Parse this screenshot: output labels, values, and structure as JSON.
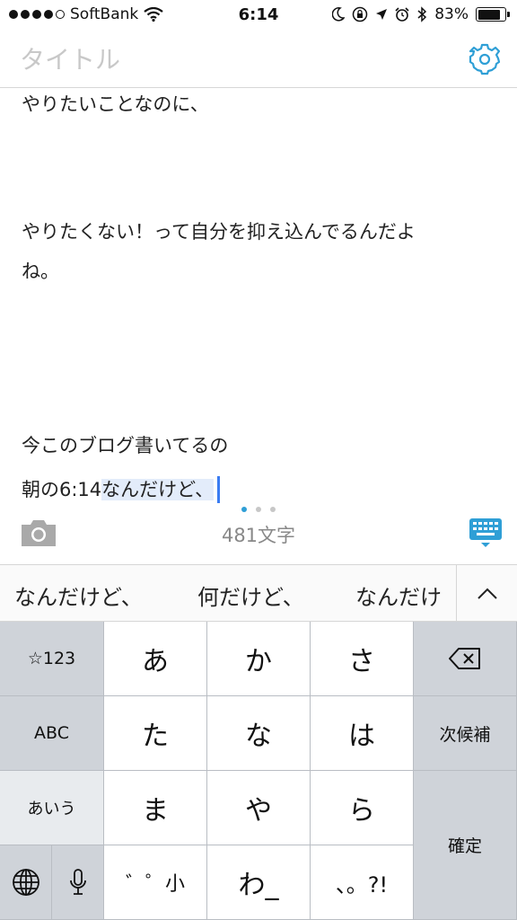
{
  "status_bar": {
    "carrier": "SoftBank",
    "time": "6:14",
    "battery": "83%",
    "battery_level": 0.83
  },
  "title": {
    "placeholder": "タイトル"
  },
  "editor": {
    "lines": [
      "やりたいことなのに、",
      "やりたくない！って自分を抑え込んでるんだよ",
      "ね。",
      "今このブログ書いてるの",
      "朝の6:14"
    ],
    "selected_text": "なんだけど、"
  },
  "toolbar": {
    "char_count": "481文字"
  },
  "suggestions": {
    "items": [
      "なんだけど、",
      "何だけど、",
      "なんだけ"
    ]
  },
  "keyboard": {
    "keys": {
      "num": "☆123",
      "a": "あ",
      "ka": "か",
      "sa": "さ",
      "abc": "ABC",
      "ta": "た",
      "na": "な",
      "ha": "は",
      "next_candidate": "次候補",
      "kana": "あいう",
      "ma": "ま",
      "ya": "や",
      "ra": "ら",
      "confirm": "確定",
      "dakuten": "゛゜小",
      "wa": "わ_",
      "punct": "、。?!"
    }
  },
  "colors": {
    "accent": "#2f9fd6",
    "cursor": "#3a7cf2",
    "selection": "#e3ecfa",
    "keyboard_bg": "#cfd3d9"
  }
}
